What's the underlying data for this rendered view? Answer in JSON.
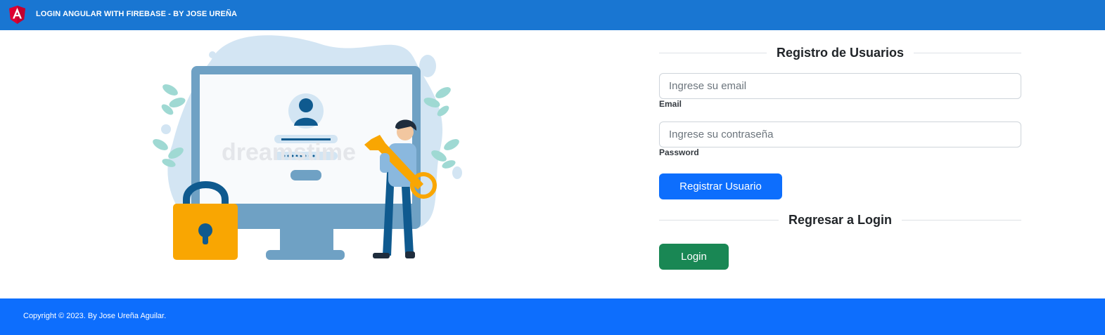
{
  "navbar": {
    "title": "LOGIN ANGULAR WITH FIREBASE - BY JOSE UREÑA",
    "logo_icon": "angular-logo-icon",
    "background": "#1976d2"
  },
  "illustration": {
    "icon": "computer-login-key-illustration",
    "watermark": "dreamstime"
  },
  "register": {
    "heading": "Registro de Usuarios",
    "email": {
      "placeholder": "Ingrese su email",
      "value": "",
      "label": "Email"
    },
    "password": {
      "placeholder": "Ingrese su contraseña",
      "value": "",
      "label": "Password"
    },
    "submit_label": "Registrar Usuario"
  },
  "back": {
    "heading": "Regresar a Login",
    "login_label": "Login"
  },
  "footer": {
    "text": "Copyright © 2023. By Jose Ureña Aguilar.",
    "background": "#0d6efd"
  },
  "colors": {
    "primary": "#0d6efd",
    "success": "#198754",
    "navbar": "#1976d2"
  }
}
